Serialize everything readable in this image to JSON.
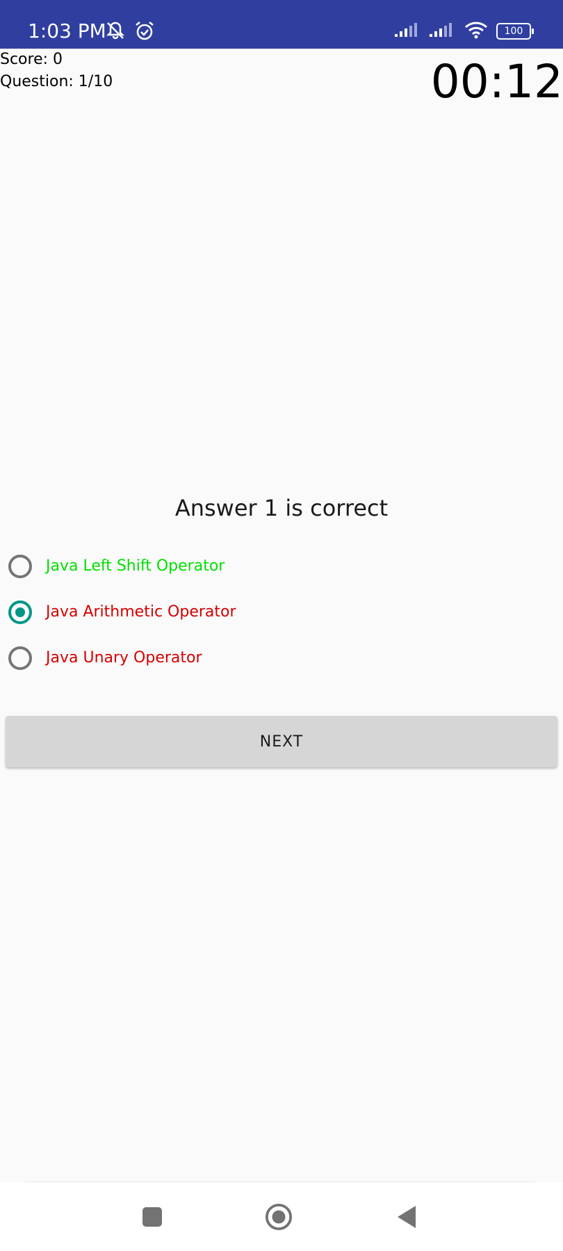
{
  "status_bar": {
    "time": "1:03 PM",
    "battery": "100",
    "background": "#303f9f",
    "icons": [
      "mute-notifications-icon",
      "alarm-icon",
      "signal-icon",
      "signal-icon",
      "wifi-icon",
      "battery-icon"
    ]
  },
  "quiz": {
    "score": "Score: 0",
    "question_counter": "Question: 1/10",
    "timer": "00:12",
    "result": "Answer 1 is correct",
    "options": [
      {
        "label": "Java Left Shift Operator",
        "checked": false,
        "color": "#00e000"
      },
      {
        "label": "Java Arithmetic Operator",
        "checked": true,
        "color": "#d50000"
      },
      {
        "label": "Java Unary Operator",
        "checked": false,
        "color": "#d50000"
      }
    ],
    "next_label": "NEXT"
  },
  "colors": {
    "accent": "#009688",
    "correct": "#00e000",
    "incorrect": "#d50000",
    "button_bg": "#d6d6d6"
  },
  "nav_bar": {
    "icons": [
      "recent-apps-icon",
      "home-icon",
      "back-icon"
    ]
  }
}
